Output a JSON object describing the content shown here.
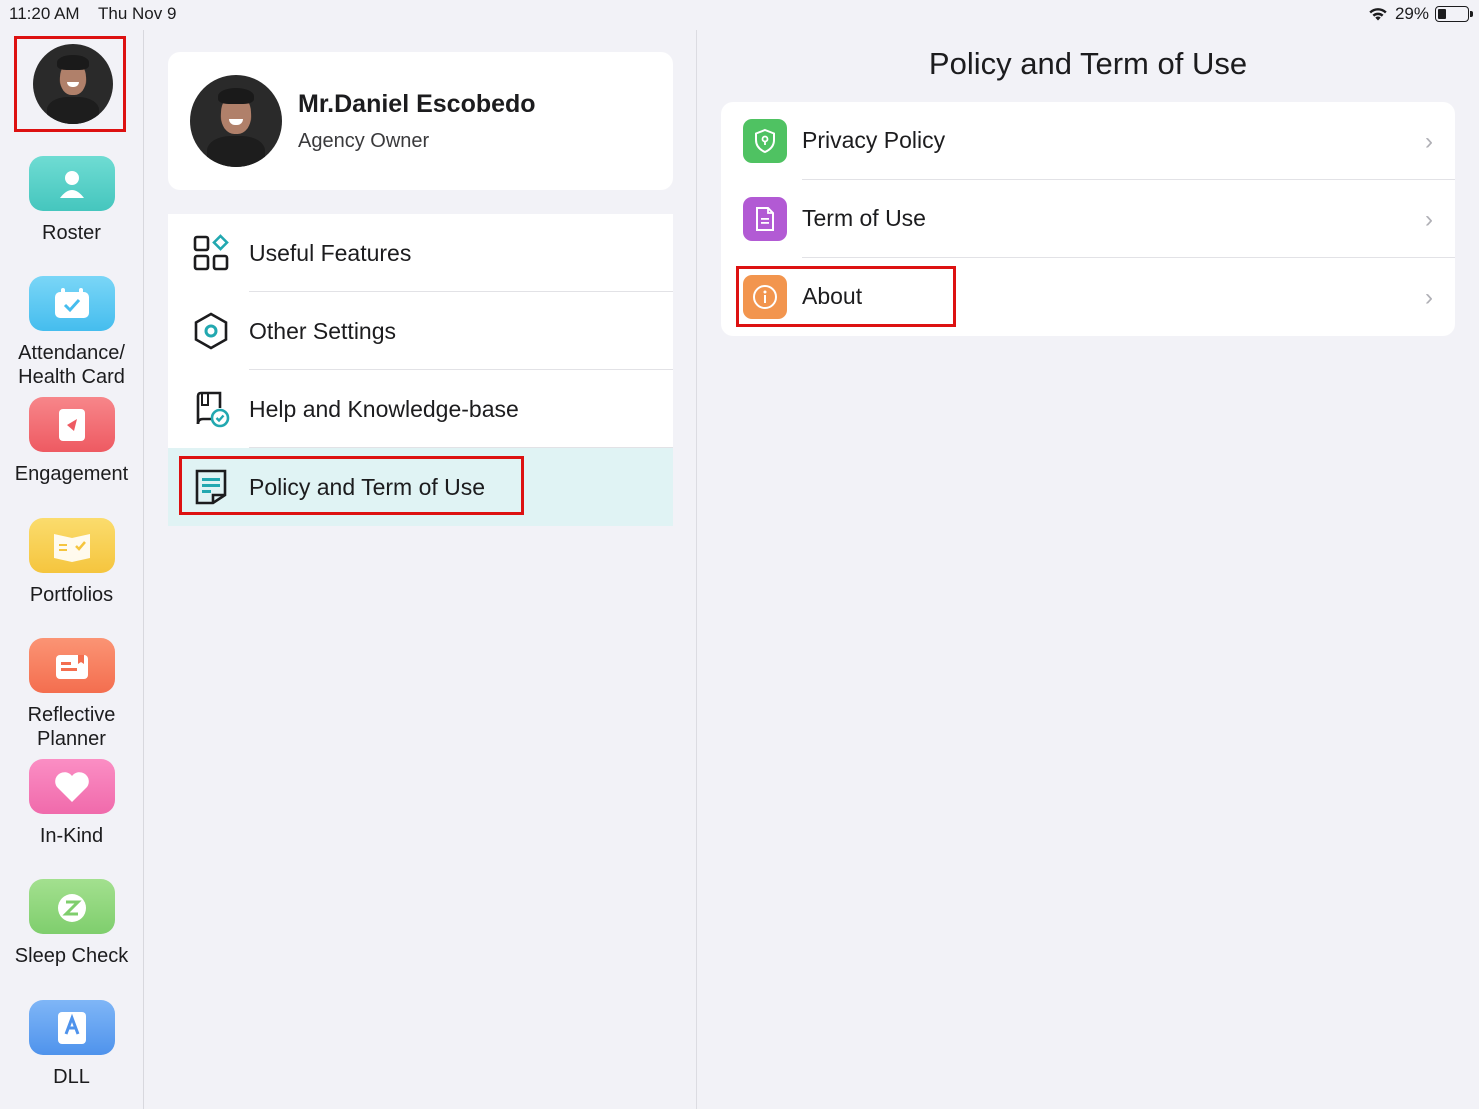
{
  "status_bar": {
    "time": "11:20 AM",
    "date": "Thu Nov 9",
    "battery": "29%"
  },
  "rail": {
    "items": [
      {
        "label": "Roster",
        "icon": "roster-icon",
        "color": "#4fd0c8"
      },
      {
        "label": "Attendance/ Health Card",
        "icon": "attendance-icon",
        "color": "#56c9f2"
      },
      {
        "label": "Engagement",
        "icon": "engagement-icon",
        "color": "#f0646a"
      },
      {
        "label": "Portfolios",
        "icon": "portfolios-icon",
        "color": "#f7cf4e"
      },
      {
        "label": "Reflective Planner",
        "icon": "planner-icon",
        "color": "#f87c5c"
      },
      {
        "label": "In-Kind",
        "icon": "heart-icon",
        "color": "#f578b4"
      },
      {
        "label": "Sleep Check",
        "icon": "sleep-icon",
        "color": "#8fd87e"
      },
      {
        "label": "DLL",
        "icon": "dll-icon",
        "color": "#5aa0f2"
      }
    ]
  },
  "profile": {
    "name": "Mr.Daniel Escobedo",
    "role": "Agency Owner"
  },
  "menu": {
    "items": [
      {
        "label": "Useful Features",
        "icon": "grid-icon"
      },
      {
        "label": "Other Settings",
        "icon": "hexagon-settings-icon"
      },
      {
        "label": "Help and Knowledge-base",
        "icon": "help-book-icon"
      },
      {
        "label": "Policy and Term of Use",
        "icon": "policy-document-icon",
        "selected": true
      }
    ]
  },
  "panel": {
    "title": "Policy and Term of Use",
    "rows": [
      {
        "label": "Privacy Policy",
        "icon": "shield-icon",
        "color": "#4fc262"
      },
      {
        "label": "Term of Use",
        "icon": "document-icon",
        "color": "#b25ad4"
      },
      {
        "label": "About",
        "icon": "info-icon",
        "color": "#f2954e"
      }
    ]
  },
  "accent_color": "#22a8b0"
}
